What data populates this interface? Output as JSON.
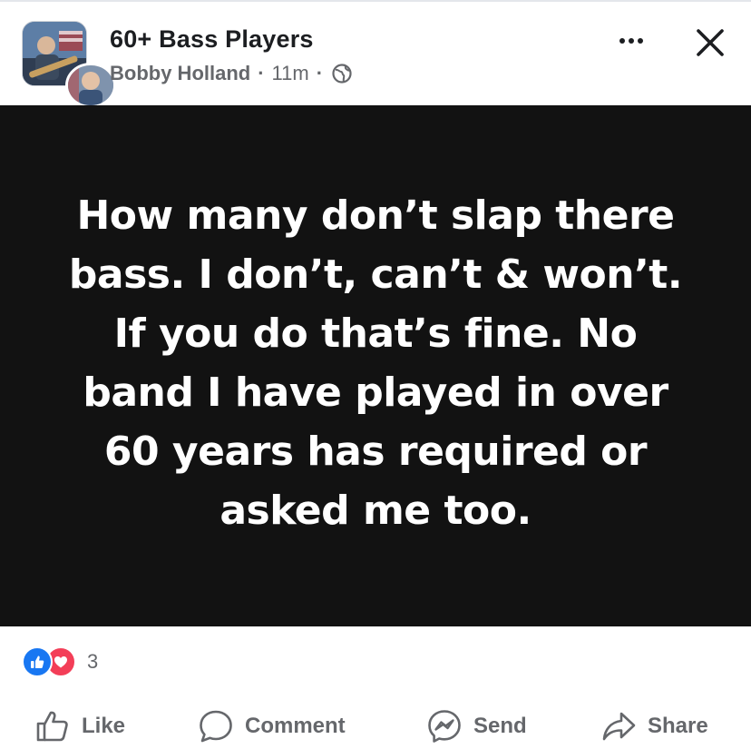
{
  "header": {
    "group_name": "60+ Bass Players",
    "author": "Bobby Holland",
    "separator": "·",
    "time": "11m",
    "privacy_icon": "globe-icon",
    "more_icon": "more-options-icon",
    "close_icon": "close-icon"
  },
  "post": {
    "background_color": "#121212",
    "text_color": "#ffffff",
    "lines": [
      "How many don’t slap there",
      "bass. I don’t, can’t & won’t.",
      "If you do that’s fine. No",
      "band I have played in over",
      "60 years has required or",
      "asked me too."
    ]
  },
  "reactions": {
    "types": [
      "like",
      "love"
    ],
    "count": "3",
    "like_color": "#1877f2",
    "love_color": "#f33e58"
  },
  "actions": {
    "like_label": "Like",
    "comment_label": "Comment",
    "send_label": "Send",
    "share_label": "Share"
  },
  "colors": {
    "primary_text": "#1c1e21",
    "secondary_text": "#65676b"
  }
}
